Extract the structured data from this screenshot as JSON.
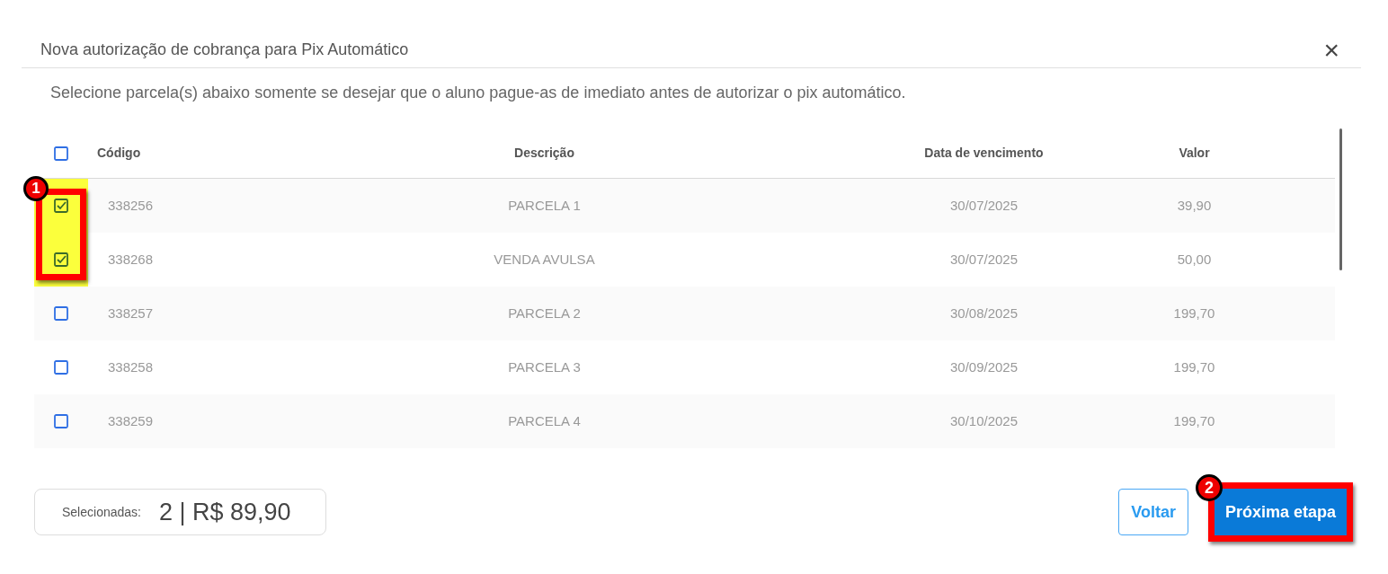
{
  "dialog": {
    "title": "Nova autorização de cobrança para Pix Automático",
    "close": "×"
  },
  "instructions": "Selecione parcela(s) abaixo somente se desejar que o aluno pague-as de imediato antes de autorizar o pix automático.",
  "table": {
    "select_all_checked": false,
    "columns": [
      "Código",
      "Descrição",
      "Data de vencimento",
      "Valor"
    ],
    "rows": [
      {
        "code": "338256",
        "description": "PARCELA 1",
        "due_date": "30/07/2025",
        "value": "39,90",
        "checked": true,
        "highlighted": true
      },
      {
        "code": "338268",
        "description": "VENDA AVULSA",
        "due_date": "30/07/2025",
        "value": "50,00",
        "checked": true,
        "highlighted": true
      },
      {
        "code": "338257",
        "description": "PARCELA 2",
        "due_date": "30/08/2025",
        "value": "199,70",
        "checked": false,
        "highlighted": false
      },
      {
        "code": "338258",
        "description": "PARCELA 3",
        "due_date": "30/09/2025",
        "value": "199,70",
        "checked": false,
        "highlighted": false
      },
      {
        "code": "338259",
        "description": "PARCELA 4",
        "due_date": "30/10/2025",
        "value": "199,70",
        "checked": false,
        "highlighted": false
      }
    ]
  },
  "summary": {
    "label": "Selecionadas:",
    "value": "2 | R$ 89,90"
  },
  "buttons": [
    {
      "label": "Voltar",
      "kind": "secondary"
    },
    {
      "label": "Próxima etapa",
      "kind": "primary"
    }
  ],
  "annotations": [
    {
      "label": "1"
    },
    {
      "label": "2"
    }
  ]
}
